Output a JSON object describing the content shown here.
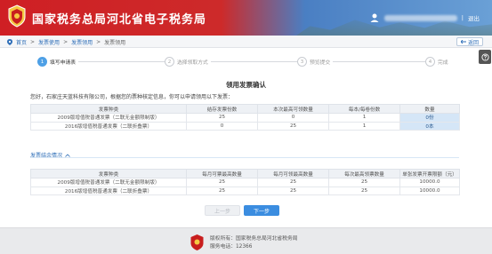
{
  "header": {
    "site_title": "国家税务总局河北省电子税务局",
    "logout_label": "退出",
    "colors": {
      "red": "#cf1f24",
      "blue": "#4a7fc3"
    }
  },
  "breadcrumb": {
    "items": [
      "首页",
      "发票使用",
      "发票领用",
      "发票领用"
    ],
    "back_label": "返回"
  },
  "steps": [
    {
      "num": "1",
      "label": "填写申请表"
    },
    {
      "num": "2",
      "label": "选择领取方式"
    },
    {
      "num": "3",
      "label": "预览提交"
    },
    {
      "num": "4",
      "label": "完成"
    }
  ],
  "page": {
    "heading": "领用发票确认",
    "intro": "您好，石家庄天蓝科技有限公司，根据您的票种核定信息，你可以申请领用以下发票："
  },
  "table1": {
    "headers": [
      "发票种类",
      "结存发票份数",
      "本次最高可领数量",
      "每本/每卷份数",
      "数量"
    ],
    "rows": [
      [
        "2009版增值税普通发票（二联无金额限制版）",
        "25",
        "0",
        "1",
        "0份"
      ],
      [
        "2016版增值税普通发票（二联折叠票）",
        "0",
        "25",
        "1",
        "0本"
      ]
    ]
  },
  "section": {
    "title": "发票结余情况"
  },
  "table2": {
    "headers": [
      "发票种类",
      "每月可票最高数量",
      "每月可领最高数量",
      "每次最高领票数量",
      "单张发票开票限额（元）"
    ],
    "rows": [
      [
        "2009版增值税普通发票（二联无金额限制版）",
        "25",
        "25",
        "25",
        "10000.0"
      ],
      [
        "2016版增值税普通发票（二联折叠票）",
        "25",
        "25",
        "25",
        "10000.0"
      ]
    ]
  },
  "buttons": {
    "prev": "上一步",
    "next": "下一步"
  },
  "footer": {
    "line1": "版权所有：国家税务总局河北省税务局",
    "line2": "服务电话：12366"
  }
}
